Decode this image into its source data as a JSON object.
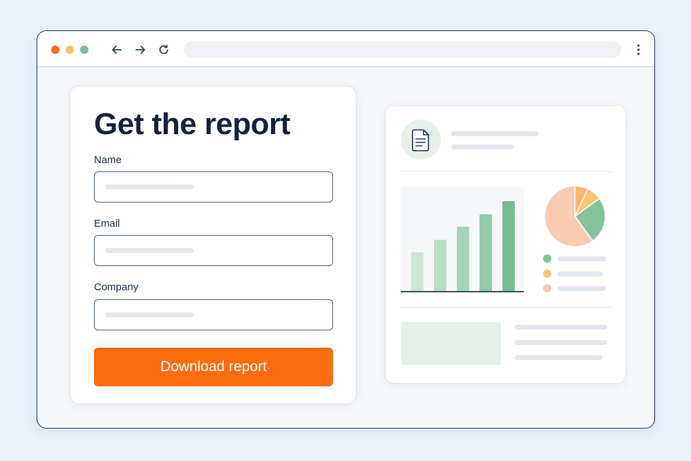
{
  "window": {
    "controls": {
      "close_color": "#f26b1f",
      "minimize_color": "#f6c26b",
      "maximize_color": "#7fbf96"
    }
  },
  "form": {
    "title": "Get the report",
    "fields": [
      {
        "label": "Name",
        "value": "",
        "placeholder": ""
      },
      {
        "label": "Email",
        "value": "",
        "placeholder": ""
      },
      {
        "label": "Company",
        "value": "",
        "placeholder": ""
      }
    ],
    "submit_label": "Download report",
    "accent_color": "#fb6d0e"
  },
  "preview": {
    "icon": "document-icon",
    "chart_data": {
      "type": "bar",
      "values": [
        3,
        4,
        5,
        6,
        7
      ],
      "colors": [
        "#cfe5d8",
        "#b9dcc8",
        "#a7d3bb",
        "#93c9ac",
        "#7dbb98"
      ]
    },
    "pie_data": {
      "type": "pie",
      "values": [
        60,
        25,
        8,
        7
      ],
      "colors": [
        "#f8cbb4",
        "#86c39d",
        "#f7c576",
        "#f9b870"
      ]
    },
    "legend_colors": [
      "#86c39d",
      "#f7c576",
      "#f8cbb4"
    ]
  }
}
